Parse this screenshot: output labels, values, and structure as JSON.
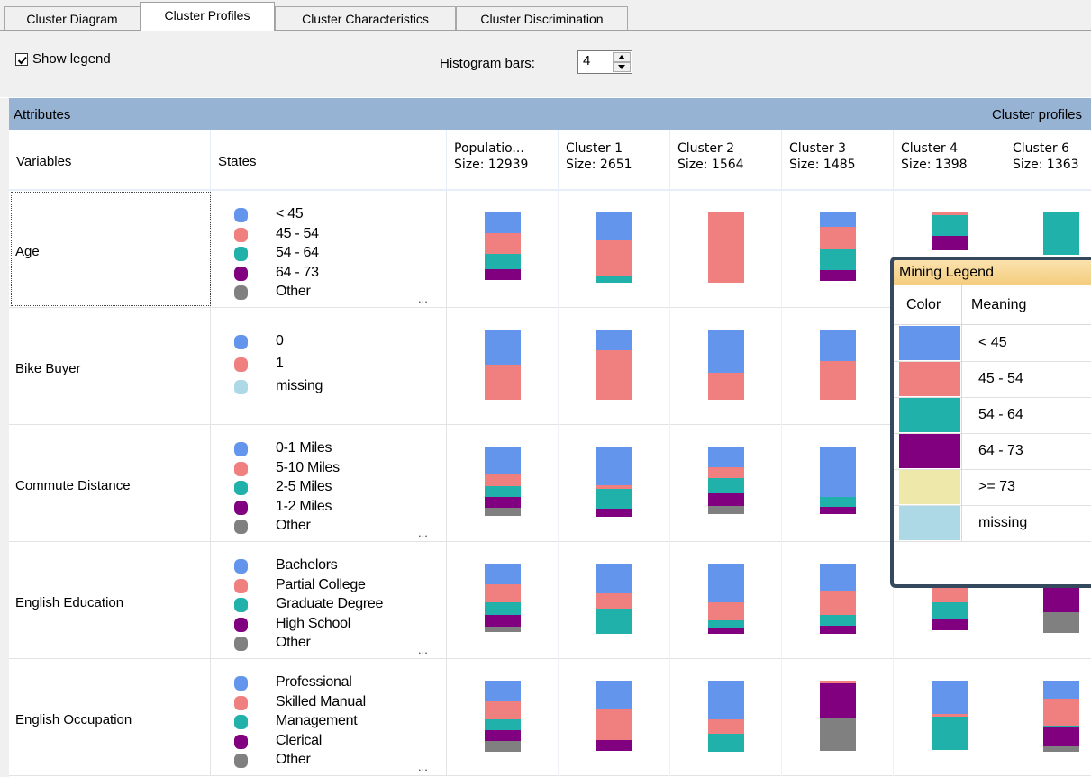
{
  "tabs": [
    "Cluster Diagram",
    "Cluster Profiles",
    "Cluster Characteristics",
    "Cluster Discrimination"
  ],
  "active_tab": "Cluster Profiles",
  "toolbar": {
    "show_legend_label": "Show legend",
    "show_legend_checked": true,
    "histogram_label": "Histogram bars:",
    "histogram_value": "4"
  },
  "grid": {
    "attributes_label": "Attributes",
    "cluster_profiles_label": "Cluster profiles",
    "variables_header": "Variables",
    "states_header": "States",
    "columns": [
      {
        "name": "Populatio...",
        "size": "Size: 12939"
      },
      {
        "name": "Cluster 1",
        "size": "Size: 2651"
      },
      {
        "name": "Cluster 2",
        "size": "Size: 1564"
      },
      {
        "name": "Cluster 3",
        "size": "Size: 1485"
      },
      {
        "name": "Cluster 4",
        "size": "Size: 1398"
      },
      {
        "name": "Cluster 6",
        "size": "Size: 1363"
      }
    ]
  },
  "colors": {
    "blue": "#6495ed",
    "salmon": "#f08080",
    "teal": "#20b2aa",
    "purple": "#800080",
    "gray": "#808080",
    "khaki": "#eee8aa",
    "lightblue": "#add8e6"
  },
  "rows": [
    {
      "variable": "Age",
      "states": [
        {
          "label": "< 45",
          "color": "blue"
        },
        {
          "label": "45 - 54",
          "color": "salmon"
        },
        {
          "label": "54 - 64",
          "color": "teal"
        },
        {
          "label": "64 - 73",
          "color": "purple"
        },
        {
          "label": "Other",
          "color": "gray"
        }
      ],
      "more": "...",
      "bars": [
        [
          [
            "blue",
            0.3
          ],
          [
            "salmon",
            0.3
          ],
          [
            "teal",
            0.22
          ],
          [
            "purple",
            0.15
          ]
        ],
        [
          [
            "blue",
            0.4
          ],
          [
            "salmon",
            0.5
          ],
          [
            "teal",
            0.1
          ]
        ],
        [
          [
            "salmon",
            1.0
          ]
        ],
        [
          [
            "blue",
            0.2
          ],
          [
            "salmon",
            0.32
          ],
          [
            "teal",
            0.3
          ],
          [
            "purple",
            0.16
          ]
        ],
        [
          [
            "salmon",
            0.04
          ],
          [
            "teal",
            0.3
          ],
          [
            "purple",
            0.2
          ]
        ],
        [
          [
            "teal",
            0.6
          ]
        ]
      ]
    },
    {
      "variable": "Bike Buyer",
      "states": [
        {
          "label": "0",
          "color": "blue"
        },
        {
          "label": "1",
          "color": "salmon"
        },
        {
          "label": "missing",
          "color": "lightblue"
        }
      ],
      "more": "",
      "bars": [
        [
          [
            "blue",
            0.5
          ],
          [
            "salmon",
            0.5
          ]
        ],
        [
          [
            "blue",
            0.3
          ],
          [
            "salmon",
            0.7
          ]
        ],
        [
          [
            "blue",
            0.62
          ],
          [
            "salmon",
            0.38
          ]
        ],
        [
          [
            "blue",
            0.45
          ],
          [
            "salmon",
            0.55
          ]
        ],
        [],
        []
      ]
    },
    {
      "variable": "Commute Distance",
      "states": [
        {
          "label": "0-1 Miles",
          "color": "blue"
        },
        {
          "label": "5-10 Miles",
          "color": "salmon"
        },
        {
          "label": "2-5 Miles",
          "color": "teal"
        },
        {
          "label": "1-2 Miles",
          "color": "purple"
        },
        {
          "label": "Other",
          "color": "gray"
        }
      ],
      "more": "...",
      "bars": [
        [
          [
            "blue",
            0.38
          ],
          [
            "salmon",
            0.18
          ],
          [
            "teal",
            0.16
          ],
          [
            "purple",
            0.16
          ],
          [
            "gray",
            0.12
          ]
        ],
        [
          [
            "blue",
            0.55
          ],
          [
            "salmon",
            0.05
          ],
          [
            "teal",
            0.28
          ],
          [
            "purple",
            0.12
          ]
        ],
        [
          [
            "blue",
            0.3
          ],
          [
            "salmon",
            0.15
          ],
          [
            "teal",
            0.22
          ],
          [
            "purple",
            0.18
          ],
          [
            "gray",
            0.12
          ]
        ],
        [
          [
            "blue",
            0.72
          ],
          [
            "teal",
            0.14
          ],
          [
            "purple",
            0.1
          ]
        ],
        [],
        []
      ]
    },
    {
      "variable": "English Education",
      "states": [
        {
          "label": "Bachelors",
          "color": "blue"
        },
        {
          "label": "Partial College",
          "color": "salmon"
        },
        {
          "label": "Graduate Degree",
          "color": "teal"
        },
        {
          "label": "High School",
          "color": "purple"
        },
        {
          "label": "Other",
          "color": "gray"
        }
      ],
      "more": "...",
      "bars": [
        [
          [
            "blue",
            0.3
          ],
          [
            "salmon",
            0.25
          ],
          [
            "teal",
            0.18
          ],
          [
            "purple",
            0.17
          ],
          [
            "gray",
            0.08
          ]
        ],
        [
          [
            "blue",
            0.42
          ],
          [
            "salmon",
            0.22
          ],
          [
            "teal",
            0.36
          ]
        ],
        [
          [
            "blue",
            0.55
          ],
          [
            "salmon",
            0.25
          ],
          [
            "teal",
            0.12
          ],
          [
            "purple",
            0.08
          ]
        ],
        [
          [
            "blue",
            0.38
          ],
          [
            "salmon",
            0.35
          ],
          [
            "teal",
            0.15
          ],
          [
            "purple",
            0.12
          ]
        ],
        [
          [
            "blue",
            0.3
          ],
          [
            "salmon",
            0.26
          ],
          [
            "teal",
            0.24
          ],
          [
            "purple",
            0.16
          ]
        ],
        [
          [
            "blue",
            0.05
          ],
          [
            "salmon",
            0.3
          ],
          [
            "purple",
            0.35
          ],
          [
            "gray",
            0.3
          ]
        ]
      ]
    },
    {
      "variable": "English Occupation",
      "states": [
        {
          "label": "Professional",
          "color": "blue"
        },
        {
          "label": "Skilled Manual",
          "color": "salmon"
        },
        {
          "label": "Management",
          "color": "teal"
        },
        {
          "label": "Clerical",
          "color": "purple"
        },
        {
          "label": "Other",
          "color": "gray"
        }
      ],
      "more": "...",
      "bars": [
        [
          [
            "blue",
            0.3
          ],
          [
            "salmon",
            0.25
          ],
          [
            "teal",
            0.15
          ],
          [
            "purple",
            0.15
          ],
          [
            "gray",
            0.15
          ]
        ],
        [
          [
            "blue",
            0.4
          ],
          [
            "salmon",
            0.45
          ],
          [
            "purple",
            0.15
          ]
        ],
        [
          [
            "blue",
            0.55
          ],
          [
            "salmon",
            0.2
          ],
          [
            "teal",
            0.25
          ]
        ],
        [
          [
            "salmon",
            0.04
          ],
          [
            "purple",
            0.5
          ],
          [
            "gray",
            0.46
          ]
        ],
        [
          [
            "blue",
            0.48
          ],
          [
            "salmon",
            0.04
          ],
          [
            "teal",
            0.48
          ]
        ],
        [
          [
            "blue",
            0.25
          ],
          [
            "salmon",
            0.38
          ],
          [
            "teal",
            0.02
          ],
          [
            "purple",
            0.27
          ],
          [
            "gray",
            0.08
          ]
        ]
      ]
    }
  ],
  "legend": {
    "title": "Mining Legend",
    "color_header": "Color",
    "meaning_header": "Meaning",
    "items": [
      {
        "color": "blue",
        "label": "< 45"
      },
      {
        "color": "salmon",
        "label": "45 - 54"
      },
      {
        "color": "teal",
        "label": "54 - 64"
      },
      {
        "color": "purple",
        "label": "64 - 73"
      },
      {
        "color": "khaki",
        "label": ">= 73"
      },
      {
        "color": "lightblue",
        "label": "missing"
      }
    ]
  }
}
